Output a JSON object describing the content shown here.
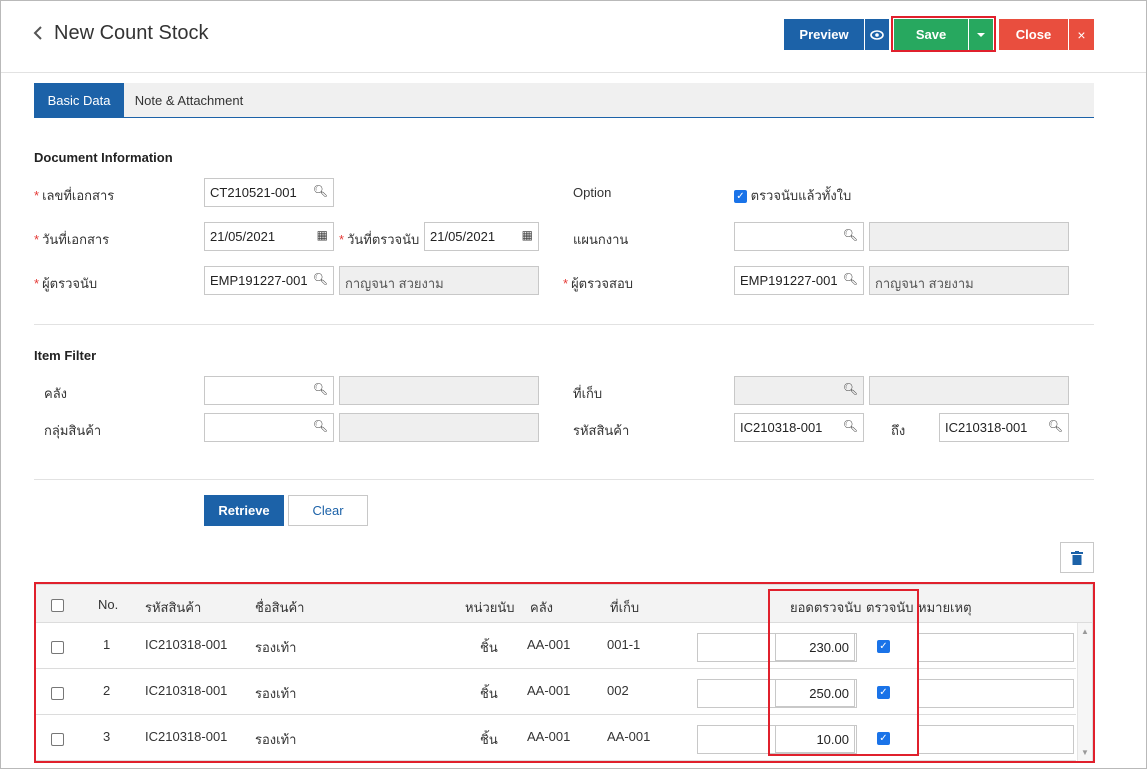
{
  "header": {
    "back_icon": "chevron-left-icon",
    "title": "New Count Stock",
    "preview_label": "Preview",
    "save_label": "Save",
    "close_label": "Close",
    "close_x": "×"
  },
  "tabs": [
    {
      "label": "Basic Data"
    },
    {
      "label": "Note & Attachment"
    }
  ],
  "document_info": {
    "section_title": "Document Information",
    "doc_no_label": "เลขที่เอกสาร",
    "doc_no_value": "CT210521-001",
    "option_label": "Option",
    "option_check_label": "ตรวจนับแล้วทั้งใบ",
    "doc_date_label": "วันที่เอกสาร",
    "doc_date_value": "21/05/2021",
    "count_date_label": "วันที่ตรวจนับ",
    "count_date_value": "21/05/2021",
    "department_label": "แผนกงาน",
    "counter_label": "ผู้ตรวจนับ",
    "counter_code": "EMP191227-001",
    "counter_name": "กาญจนา สวยงาม",
    "checker_label": "ผู้ตรวจสอบ",
    "checker_code": "EMP191227-001",
    "checker_name": "กาญจนา สวยงาม"
  },
  "item_filter": {
    "section_title": "Item Filter",
    "warehouse_label": "คลัง",
    "location_label": "ที่เก็บ",
    "group_label": "กลุ่มสินค้า",
    "product_code_label": "รหัสสินค้า",
    "product_from": "IC210318-001",
    "to_label": "ถึง",
    "product_to": "IC210318-001",
    "retrieve_label": "Retrieve",
    "clear_label": "Clear"
  },
  "grid": {
    "columns": {
      "no": "No.",
      "code": "รหัสสินค้า",
      "name": "ชื่อสินค้า",
      "unit": "หน่วยนับ",
      "warehouse": "คลัง",
      "location": "ที่เก็บ",
      "count_qty": "ยอดตรวจนับ",
      "counted": "ตรวจนับ",
      "remark": "หมายเหตุ"
    },
    "rows": [
      {
        "no": "1",
        "code": "IC210318-001",
        "name": "รองเท้า",
        "unit": "ชิ้น",
        "warehouse": "AA-001",
        "location": "001-1",
        "qty": "230.00",
        "counted": true
      },
      {
        "no": "2",
        "code": "IC210318-001",
        "name": "รองเท้า",
        "unit": "ชิ้น",
        "warehouse": "AA-001",
        "location": "002",
        "qty": "250.00",
        "counted": true
      },
      {
        "no": "3",
        "code": "IC210318-001",
        "name": "รองเท้า",
        "unit": "ชิ้น",
        "warehouse": "AA-001",
        "location": "AA-001",
        "qty": "10.00",
        "counted": true
      }
    ]
  },
  "colors": {
    "primary": "#1c62a8",
    "save": "#27a85f",
    "close": "#e94e3e",
    "highlight": "#e0202c"
  }
}
